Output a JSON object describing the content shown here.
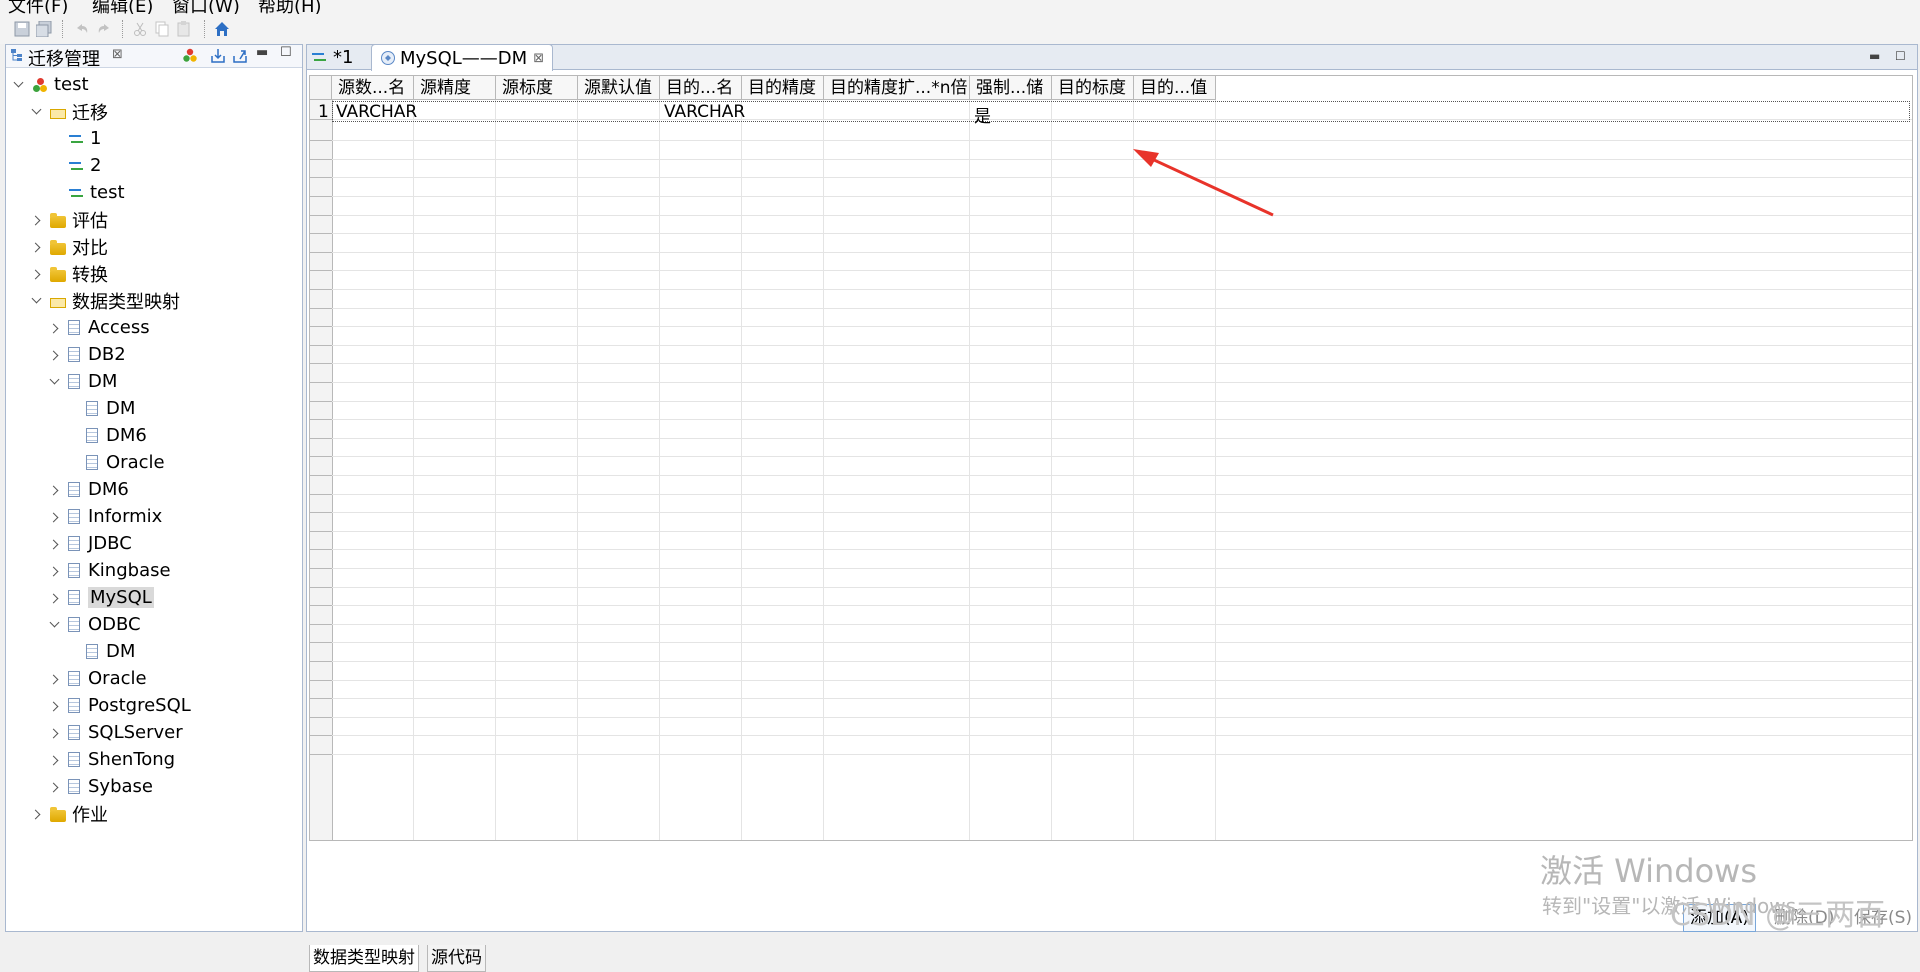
{
  "menu": {
    "items": [
      "文件(F)",
      "编辑(E)",
      "窗口(W)",
      "帮助(H)"
    ]
  },
  "toolbar": {
    "icons": [
      "save-icon",
      "save-all-icon",
      "undo-icon",
      "redo-icon",
      "cut-icon",
      "copy-icon",
      "paste-icon",
      "home-icon"
    ]
  },
  "left_panel": {
    "title": "迁移管理",
    "tree": [
      {
        "label": "test",
        "level": 0,
        "icon": "project",
        "twisty": "expanded"
      },
      {
        "label": "迁移",
        "level": 1,
        "icon": "folder-open",
        "twisty": "expanded"
      },
      {
        "label": "1",
        "level": 2,
        "icon": "arrows",
        "twisty": "none"
      },
      {
        "label": "2",
        "level": 2,
        "icon": "arrows",
        "twisty": "none"
      },
      {
        "label": "test",
        "level": 2,
        "icon": "arrows",
        "twisty": "none"
      },
      {
        "label": "评估",
        "level": 1,
        "icon": "folder",
        "twisty": "collapsed"
      },
      {
        "label": "对比",
        "level": 1,
        "icon": "folder",
        "twisty": "collapsed"
      },
      {
        "label": "转换",
        "level": 1,
        "icon": "folder",
        "twisty": "collapsed"
      },
      {
        "label": "数据类型映射",
        "level": 1,
        "icon": "folder-open",
        "twisty": "expanded"
      },
      {
        "label": "Access",
        "level": 2,
        "icon": "table",
        "twisty": "collapsed"
      },
      {
        "label": "DB2",
        "level": 2,
        "icon": "table",
        "twisty": "collapsed"
      },
      {
        "label": "DM",
        "level": 2,
        "icon": "table",
        "twisty": "expanded"
      },
      {
        "label": "DM",
        "level": 3,
        "icon": "table",
        "twisty": "none"
      },
      {
        "label": "DM6",
        "level": 3,
        "icon": "table",
        "twisty": "none"
      },
      {
        "label": "Oracle",
        "level": 3,
        "icon": "table",
        "twisty": "none"
      },
      {
        "label": "DM6",
        "level": 2,
        "icon": "table",
        "twisty": "collapsed"
      },
      {
        "label": "Informix",
        "level": 2,
        "icon": "table",
        "twisty": "collapsed"
      },
      {
        "label": "JDBC",
        "level": 2,
        "icon": "table",
        "twisty": "collapsed"
      },
      {
        "label": "Kingbase",
        "level": 2,
        "icon": "table",
        "twisty": "collapsed"
      },
      {
        "label": "MySQL",
        "level": 2,
        "icon": "table",
        "twisty": "collapsed",
        "selected": true
      },
      {
        "label": "ODBC",
        "level": 2,
        "icon": "table",
        "twisty": "expanded"
      },
      {
        "label": "DM",
        "level": 3,
        "icon": "table",
        "twisty": "none"
      },
      {
        "label": "Oracle",
        "level": 2,
        "icon": "table",
        "twisty": "collapsed"
      },
      {
        "label": "PostgreSQL",
        "level": 2,
        "icon": "table",
        "twisty": "collapsed"
      },
      {
        "label": "SQLServer",
        "level": 2,
        "icon": "table",
        "twisty": "collapsed"
      },
      {
        "label": "ShenTong",
        "level": 2,
        "icon": "table",
        "twisty": "collapsed"
      },
      {
        "label": "Sybase",
        "level": 2,
        "icon": "table",
        "twisty": "collapsed"
      },
      {
        "label": "作业",
        "level": 1,
        "icon": "folder",
        "twisty": "collapsed"
      }
    ]
  },
  "editor": {
    "tabs": [
      {
        "label": "*1",
        "active": false
      },
      {
        "label": "MySQL——DM",
        "active": true
      }
    ],
    "grid": {
      "columns": [
        "源数...名",
        "源精度",
        "源标度",
        "源默认值",
        "目的...名",
        "目的精度",
        "目的精度扩...*n倍)",
        "强制...储",
        "目的标度",
        "目的...值"
      ],
      "rows": [
        {
          "num": "1",
          "cells": [
            "VARCHAR",
            "",
            "",
            "",
            "VARCHAR",
            "",
            "",
            "是",
            "",
            ""
          ]
        }
      ]
    },
    "buttons": {
      "add": "添加(A)",
      "delete": "删除(D)",
      "save": "保存(S)"
    },
    "bottom_tabs": [
      "数据类型映射",
      "源代码"
    ]
  },
  "watermark": {
    "line1": "激活 Windows",
    "line2": "转到\"设置\"以激活 Windows。",
    "csdn": "CSDN @三两百"
  },
  "colors": {
    "annotation_arrow": "#e8332a",
    "tree_selection": "#d9d9d9",
    "panel_border": "#a9b8cf"
  }
}
